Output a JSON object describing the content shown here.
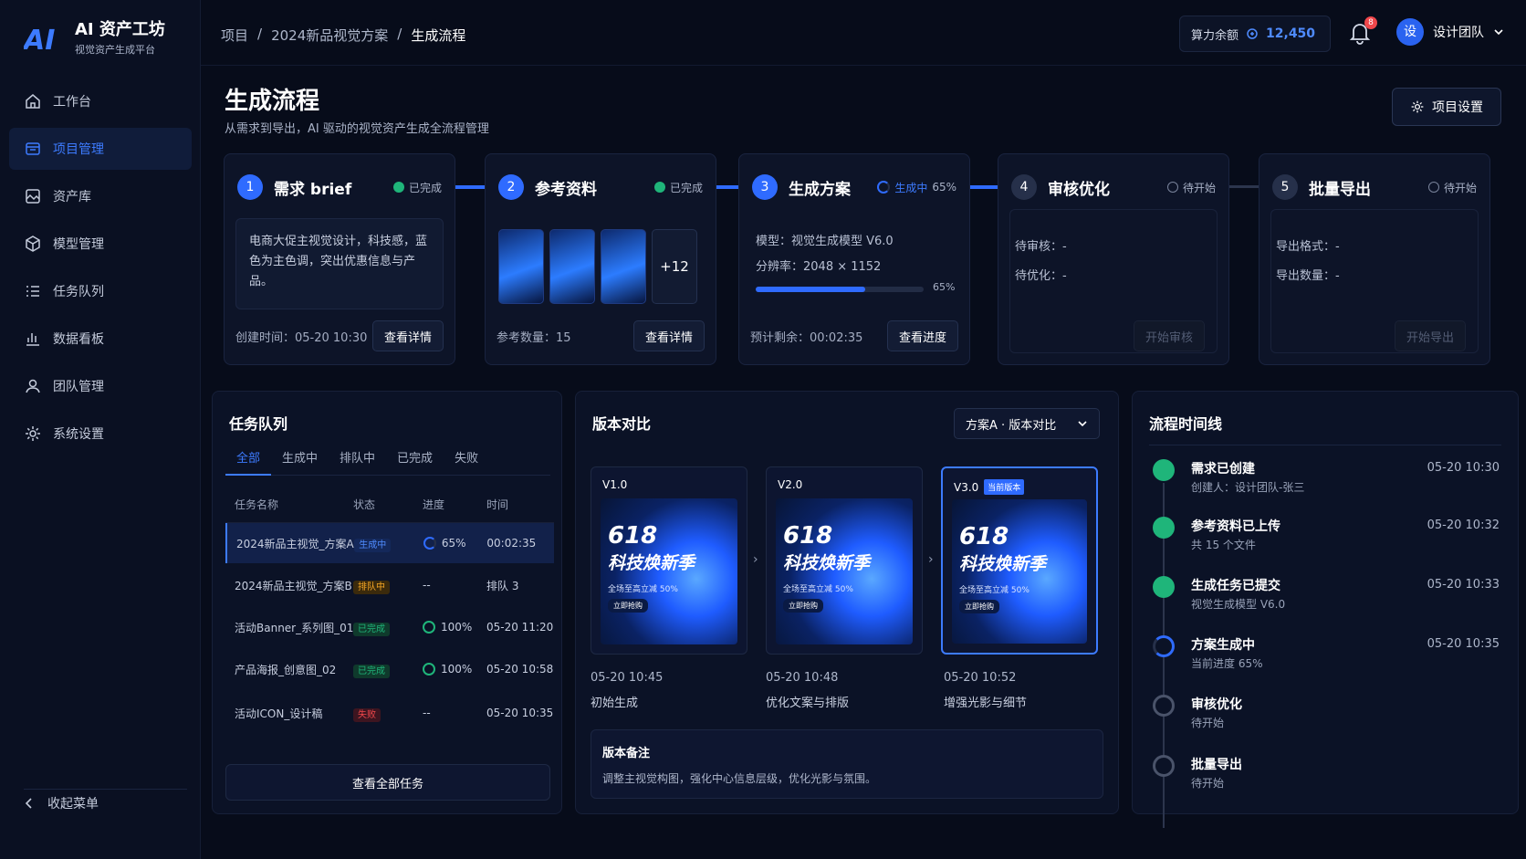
{
  "brand": {
    "title": "AI 资产工坊",
    "subtitle": "视觉资产生成平台",
    "mark": "AI"
  },
  "sidebar": {
    "items": [
      {
        "label": "工作台",
        "icon": "home-icon"
      },
      {
        "label": "项目管理",
        "icon": "folder-icon",
        "active": true
      },
      {
        "label": "资产库",
        "icon": "image-icon"
      },
      {
        "label": "模型管理",
        "icon": "cube-icon"
      },
      {
        "label": "任务队列",
        "icon": "list-icon"
      },
      {
        "label": "数据看板",
        "icon": "chart-icon"
      },
      {
        "label": "团队管理",
        "icon": "team-icon"
      },
      {
        "label": "系统设置",
        "icon": "gear-icon"
      }
    ],
    "collapse_label": "收起菜单"
  },
  "header": {
    "breadcrumb": [
      "项目",
      "2024新品视觉方案",
      "生成流程"
    ],
    "balance_label": "算力余额",
    "balance_value": "12,450",
    "notification_count": "8",
    "avatar_char": "设",
    "user_name": "设计团队"
  },
  "page": {
    "title": "生成流程",
    "subtitle": "从需求到导出，AI 驱动的视觉资产生成全流程管理",
    "settings_label": "项目设置"
  },
  "steps": [
    {
      "num": "1",
      "name": "需求 brief",
      "status": "已完成",
      "brief": "电商大促主视觉设计，科技感，蓝色为主色调，突出优惠信息与产品。",
      "footer": "创建时间：05-20 10:30",
      "button": "查看详情"
    },
    {
      "num": "2",
      "name": "参考资料",
      "status": "已完成",
      "more": "+12",
      "footer": "参考数量：15",
      "button": "查看详情"
    },
    {
      "num": "3",
      "name": "生成方案",
      "status": "生成中",
      "status_pct": "65%",
      "model": "模型：视觉生成模型 V6.0",
      "resolution": "分辨率：2048 × 1152",
      "progress": 0.65,
      "progress_label": "65%",
      "footer": "预计剩余：00:02:35",
      "button": "查看进度"
    },
    {
      "num": "4",
      "name": "审核优化",
      "status": "待开始",
      "line1": "待审核：-",
      "line2": "待优化：-",
      "button": "开始审核"
    },
    {
      "num": "5",
      "name": "批量导出",
      "status": "待开始",
      "line1": "导出格式：-",
      "line2": "导出数量：-",
      "button": "开始导出"
    }
  ],
  "queue": {
    "title": "任务队列",
    "tabs": [
      "全部",
      "生成中",
      "排队中",
      "已完成",
      "失败"
    ],
    "columns": [
      "任务名称",
      "状态",
      "进度",
      "时间"
    ],
    "rows": [
      {
        "name": "2024新品主视觉_方案A",
        "status": "生成中",
        "progress": "65%",
        "time": "00:02:35"
      },
      {
        "name": "2024新品主视觉_方案B",
        "status": "排队中",
        "progress": "--",
        "time": "排队 3"
      },
      {
        "name": "活动Banner_系列图_01",
        "status": "已完成",
        "progress": "100%",
        "time": "05-20 11:20"
      },
      {
        "name": "产品海报_创意图_02",
        "status": "已完成",
        "progress": "100%",
        "time": "05-20 10:58"
      },
      {
        "name": "活动ICON_设计稿",
        "status": "失败",
        "progress": "--",
        "time": "05-20 10:35"
      }
    ],
    "view_all": "查看全部任务"
  },
  "versions": {
    "title": "版本对比",
    "select": "方案A · 版本对比",
    "cards": [
      {
        "label": "V1.0",
        "time": "05-20 10:45",
        "desc": "初始生成"
      },
      {
        "label": "V2.0",
        "time": "05-20 10:48",
        "desc": "优化文案与排版"
      },
      {
        "label": "V3.0",
        "badge": "当前版本",
        "time": "05-20 10:52",
        "desc": "增强光影与细节"
      }
    ],
    "poster": {
      "line1": "618",
      "line2": "科技焕新季",
      "sub": "全场至高立减 50%",
      "btn": "立即抢购"
    },
    "note_title": "版本备注",
    "note_text": "调整主视觉构图，强化中心信息层级，优化光影与氛围。"
  },
  "timeline": {
    "title": "流程时间线",
    "items": [
      {
        "title": "需求已创建",
        "sub": "创建人：设计团队-张三",
        "time": "05-20 10:30",
        "state": "done"
      },
      {
        "title": "参考资料已上传",
        "sub": "共 15 个文件",
        "time": "05-20 10:32",
        "state": "done"
      },
      {
        "title": "生成任务已提交",
        "sub": "视觉生成模型 V6.0",
        "time": "05-20 10:33",
        "state": "done"
      },
      {
        "title": "方案生成中",
        "sub": "当前进度 65%",
        "time": "05-20 10:35",
        "state": "doing"
      },
      {
        "title": "审核优化",
        "sub": "待开始",
        "time": "",
        "state": "wait"
      },
      {
        "title": "批量导出",
        "sub": "待开始",
        "time": "",
        "state": "wait"
      }
    ]
  },
  "colors": {
    "accent": "#2f6bff",
    "success": "#1fb57a",
    "warning": "#f3a524",
    "danger": "#f0474b",
    "bg": "#070c1a"
  }
}
